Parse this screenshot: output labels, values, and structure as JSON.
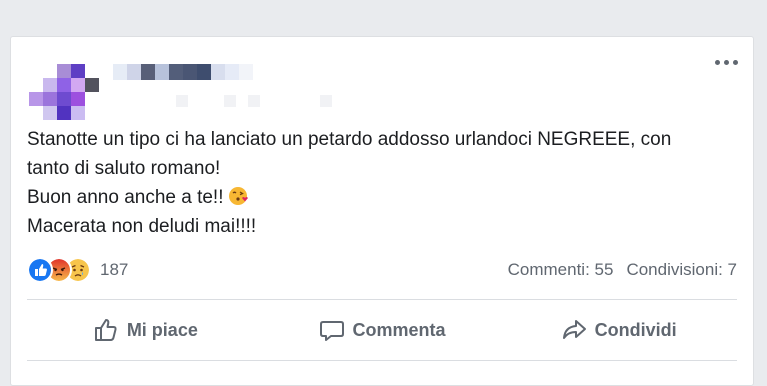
{
  "post": {
    "lines": [
      "Stanotte un tipo ci ha lanciato un petardo addosso urlandoci NEGREEE, con",
      "tanto di saluto romano!",
      "Buon anno anche a te!!",
      "Macerata non deludi mai!!!!"
    ],
    "emoji": "face-blowing-kiss-icon"
  },
  "reactions": {
    "icons": [
      "like-icon",
      "angry-icon",
      "sad-icon"
    ],
    "count": "187"
  },
  "stats": {
    "comments": "Commenti: 55",
    "shares": "Condivisioni: 7"
  },
  "actions": {
    "like": "Mi piace",
    "comment": "Commenta",
    "share": "Condividi"
  },
  "colors": {
    "background": "#e9ebee",
    "card": "#ffffff",
    "text": "#1c1e21",
    "muted": "#606770",
    "like_blue": "#1877f2",
    "angry": "#f0623a",
    "sad": "#f7c54b"
  }
}
